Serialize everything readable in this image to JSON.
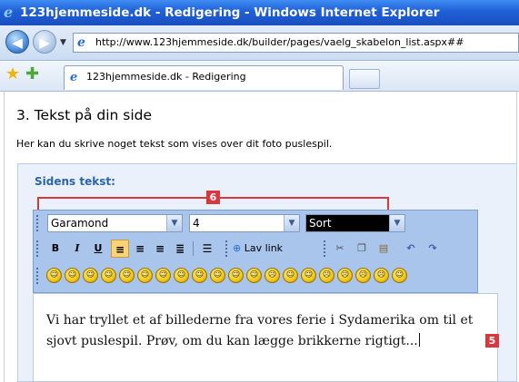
{
  "window": {
    "title": "123hjemmeside.dk - Redigering - Windows Internet Explorer"
  },
  "browser": {
    "url": "http://www.123hjemmeside.dk/builder/pages/vaelg_skabelon_list.aspx##",
    "tab_label": "123hjemmeside.dk - Redigering"
  },
  "page": {
    "heading": "3. Tekst på din side",
    "intro": "Her kan du skrive noget tekst som vises over dit foto puslespil.",
    "panel_heading": "Sidens tekst:"
  },
  "editor_toolbar": {
    "font_family": "Garamond",
    "font_size": "4",
    "font_color": "Sort",
    "bold_label": "B",
    "italic_label": "I",
    "underline_label": "U",
    "link_label": "Lav link",
    "active_alignment": "align-left"
  },
  "editor": {
    "text": "Vi har tryllet et af billederne fra vores ferie i Sydamerika om til et sjovt puslespil. Prøv, om du kan lægge brikkerne rigtigt..."
  },
  "annotations": {
    "badge_font_controls": "6",
    "badge_text_area": "5"
  },
  "colors": {
    "titlebar": "#1f5fd6",
    "accent_heading": "#2b64a8",
    "annotation_red": "#d9363e",
    "toolbar_bg": "#a9c5ec",
    "active_button": "#f9d27a"
  }
}
